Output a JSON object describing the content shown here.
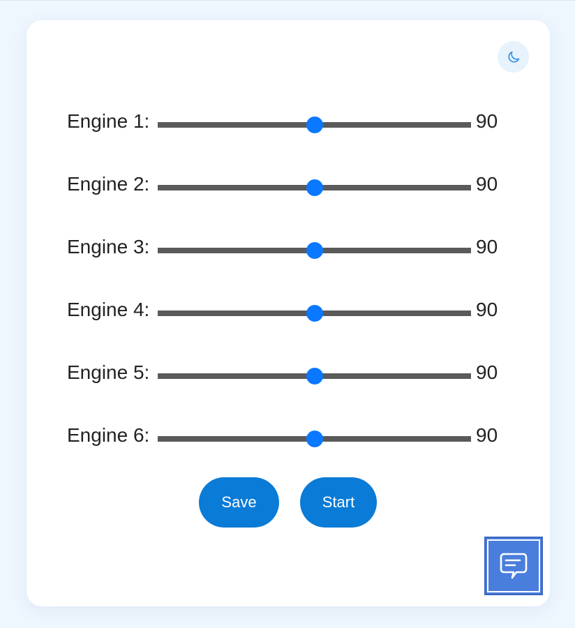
{
  "theme_toggle": {
    "icon": "moon-icon"
  },
  "engines": [
    {
      "label": "Engine 1:",
      "value": "90",
      "fraction": 0.5
    },
    {
      "label": "Engine 2:",
      "value": "90",
      "fraction": 0.5
    },
    {
      "label": "Engine 3:",
      "value": "90",
      "fraction": 0.5
    },
    {
      "label": "Engine 4:",
      "value": "90",
      "fraction": 0.5
    },
    {
      "label": "Engine 5:",
      "value": "90",
      "fraction": 0.5
    },
    {
      "label": "Engine 6:",
      "value": "90",
      "fraction": 0.5
    }
  ],
  "actions": {
    "save_label": "Save",
    "start_label": "Start"
  },
  "chat": {
    "icon": "chat-icon"
  },
  "colors": {
    "accent": "#0a78ff",
    "button": "#0a7bd6",
    "track": "#5a5a5a",
    "chat": "#4a7edc",
    "background": "#eef6fe"
  }
}
